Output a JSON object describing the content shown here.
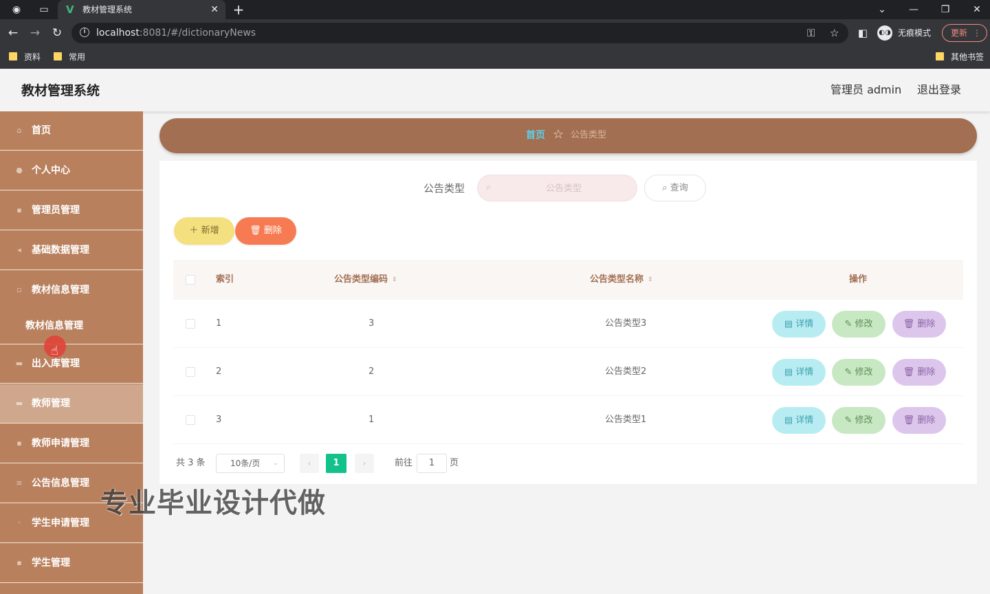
{
  "browser": {
    "tab_title": "教材管理系统",
    "url_host": "localhost",
    "url_rest": ":8081/#/dictionaryNews",
    "incognito_label": "无痕模式",
    "update_label": "更新",
    "bookmarks": [
      "资料",
      "常用"
    ],
    "other_bookmarks": "其他书签"
  },
  "header": {
    "title": "教材管理系统",
    "user_label": "管理员 admin",
    "logout_label": "退出登录"
  },
  "sidebar": {
    "items": [
      {
        "label": "首页",
        "icon": "home-icon"
      },
      {
        "label": "个人中心",
        "icon": "user-icon"
      },
      {
        "label": "管理员管理",
        "icon": "admin-icon"
      },
      {
        "label": "基础数据管理",
        "icon": "data-icon"
      },
      {
        "label": "教材信息管理",
        "icon": "book-icon"
      },
      {
        "label": "出入库管理",
        "icon": "stock-icon"
      },
      {
        "label": "教师管理",
        "icon": "teacher-icon"
      },
      {
        "label": "教师申请管理",
        "icon": "apply-icon"
      },
      {
        "label": "公告信息管理",
        "icon": "notice-icon"
      },
      {
        "label": "学生申请管理",
        "icon": "student-apply-icon"
      },
      {
        "label": "学生管理",
        "icon": "student-icon"
      }
    ],
    "submenu_label": "教材信息管理"
  },
  "breadcrumb": {
    "home": "首页",
    "current": "公告类型"
  },
  "search": {
    "label": "公告类型",
    "placeholder": "公告类型",
    "query_label": "查询"
  },
  "toolbar": {
    "add_label": "新增",
    "delete_label": "删除"
  },
  "table": {
    "columns": [
      "索引",
      "公告类型编码",
      "公告类型名称",
      "操作"
    ],
    "rows": [
      {
        "index": "1",
        "code": "3",
        "name": "公告类型3"
      },
      {
        "index": "2",
        "code": "2",
        "name": "公告类型2"
      },
      {
        "index": "3",
        "code": "1",
        "name": "公告类型1"
      }
    ],
    "actions": {
      "detail": "详情",
      "edit": "修改",
      "delete": "删除"
    }
  },
  "pagination": {
    "total_text": "共 3 条",
    "page_size": "10条/页",
    "current_page": "1",
    "goto_label": "前往",
    "goto_value": "1",
    "page_unit": "页"
  },
  "watermark": "专业毕业设计代做",
  "colors": {
    "sidebar": "#b9805d",
    "breadcrumb": "#a36f52",
    "accent_page": "#13c18a"
  }
}
